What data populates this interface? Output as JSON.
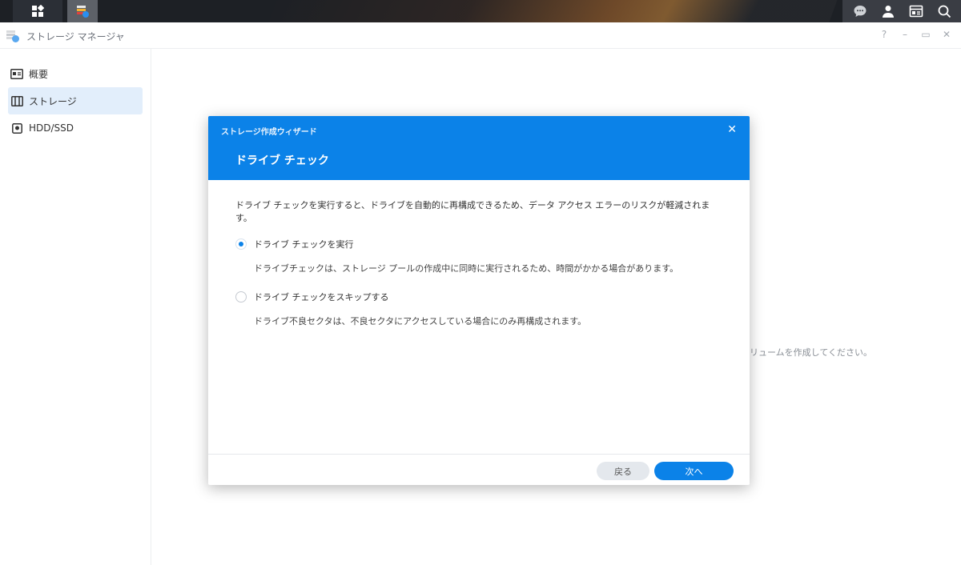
{
  "window": {
    "title": "ストレージ マネージャ",
    "controls": [
      "?",
      "–",
      "▭",
      "✕"
    ]
  },
  "sidebar": {
    "items": [
      {
        "label": "概要",
        "icon": "overview-icon"
      },
      {
        "label": "ストレージ",
        "icon": "storage-icon",
        "active": true
      },
      {
        "label": "HDD/SSD",
        "icon": "disk-icon"
      }
    ]
  },
  "background": {
    "partial_text": "リュームを作成してください。"
  },
  "dialog": {
    "wizard_title": "ストレージ作成ウィザード",
    "step_title": "ドライブ チェック",
    "description": "ドライブ チェックを実行すると、ドライブを自動的に再構成できるため、データ アクセス エラーのリスクが軽減されます。",
    "options": [
      {
        "label": "ドライブ チェックを実行",
        "detail": "ドライブチェックは、ストレージ プールの作成中に同時に実行されるため、時間がかかる場合があります。",
        "selected": true
      },
      {
        "label": "ドライブ チェックをスキップする",
        "detail": "ドライブ不良セクタは、不良セクタにアクセスしている場合にのみ再構成されます。",
        "selected": false
      }
    ],
    "back_label": "戻る",
    "next_label": "次へ",
    "accent": "#0b82e8"
  }
}
